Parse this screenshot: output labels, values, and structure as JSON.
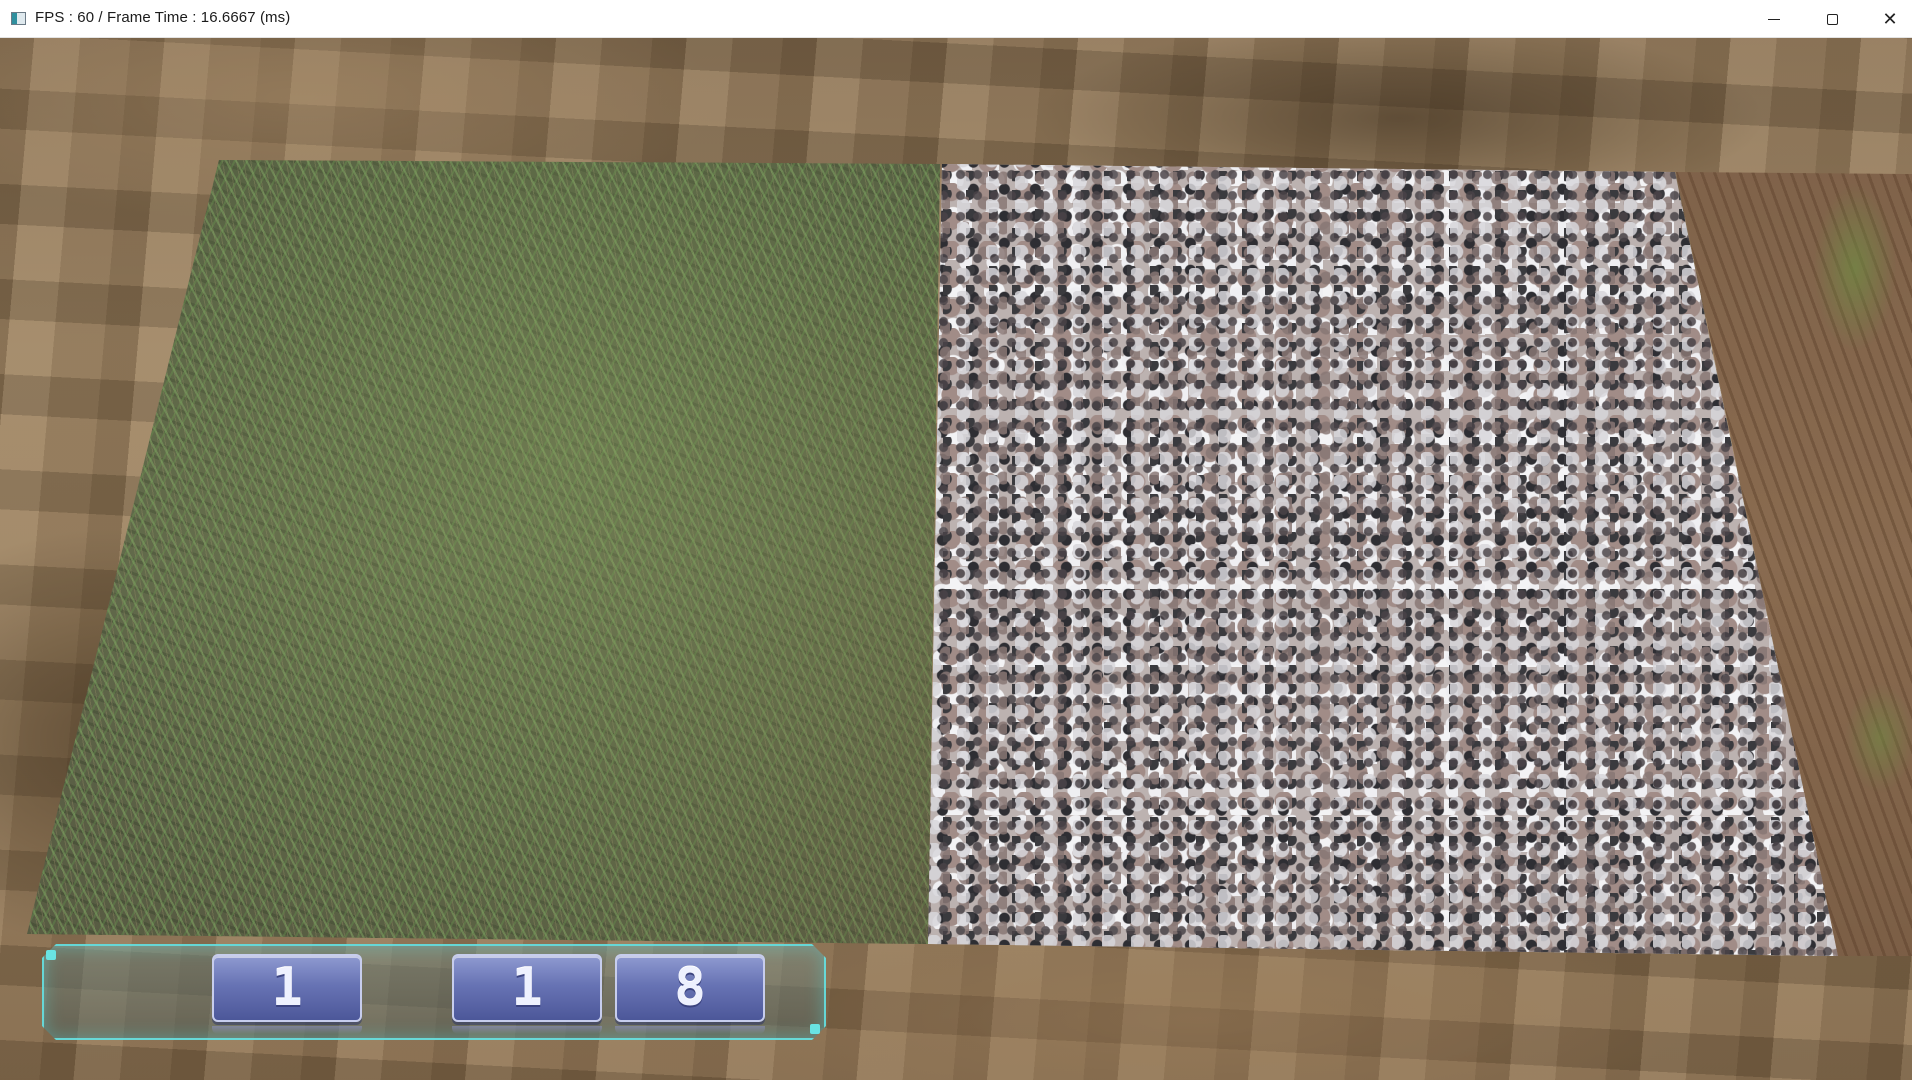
{
  "window": {
    "title": "FPS : 60 / Frame Time : 16.6667 (ms)",
    "icon": "app-window-icon",
    "controls": [
      "minimize-icon",
      "maximize-icon",
      "close-icon"
    ],
    "close_glyph": "✕"
  },
  "scene": {
    "textures": [
      "grass",
      "granite",
      "dirt"
    ],
    "background": "blurred-dirt"
  },
  "hud": {
    "digits": [
      "1",
      "1",
      "8"
    ],
    "accent_color": "#5ee6e6",
    "digit_color": "#6573bb"
  }
}
